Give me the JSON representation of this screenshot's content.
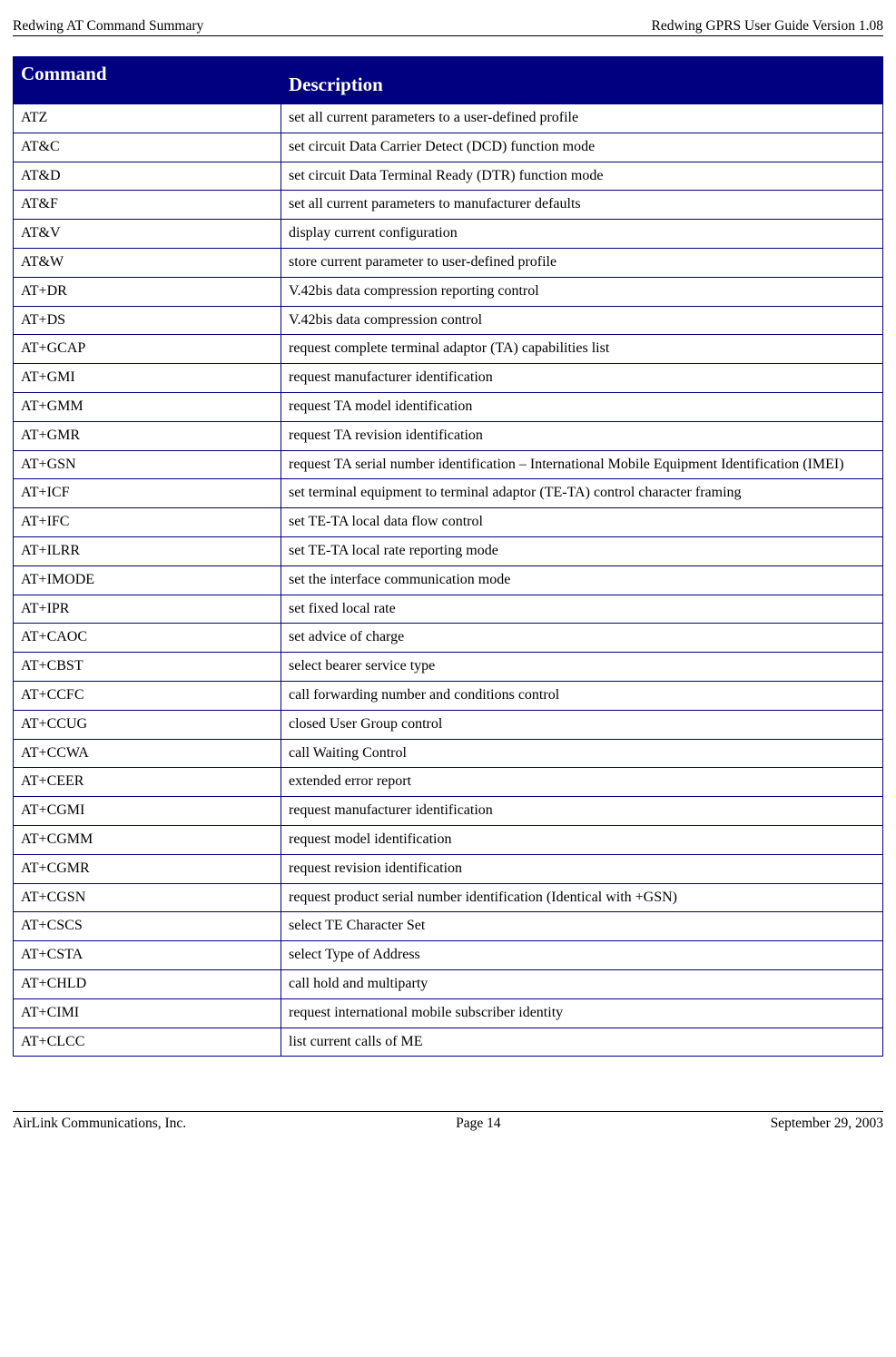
{
  "header": {
    "left": "Redwing AT Command Summary",
    "right": "Redwing GPRS User Guide Version 1.08"
  },
  "table": {
    "header": {
      "command": "Command",
      "description": "Description"
    },
    "rows": [
      {
        "command": "ATZ",
        "description": "set all current parameters to a user-defined profile"
      },
      {
        "command": "AT&C",
        "description": "set circuit Data Carrier Detect (DCD) function mode"
      },
      {
        "command": "AT&D",
        "description": "set circuit Data Terminal Ready (DTR) function mode"
      },
      {
        "command": "AT&F",
        "description": "set all current parameters to manufacturer defaults"
      },
      {
        "command": "AT&V",
        "description": "display current configuration"
      },
      {
        "command": "AT&W",
        "description": "store current parameter to user-defined profile"
      },
      {
        "command": "AT+DR",
        "description": "V.42bis data compression reporting control"
      },
      {
        "command": "AT+DS",
        "description": "V.42bis data compression control"
      },
      {
        "command": "AT+GCAP",
        "description": "request complete terminal adaptor (TA) capabilities list"
      },
      {
        "command": "AT+GMI",
        "description": "request manufacturer identification"
      },
      {
        "command": "AT+GMM",
        "description": "request TA model identification"
      },
      {
        "command": "AT+GMR",
        "description": "request TA revision identification"
      },
      {
        "command": "AT+GSN",
        "description": "request TA serial number identification – International Mobile Equipment Identification (IMEI)"
      },
      {
        "command": "AT+ICF",
        "description": "set terminal equipment to terminal adaptor (TE-TA) control character framing"
      },
      {
        "command": "AT+IFC",
        "description": "set TE-TA local data flow control"
      },
      {
        "command": "AT+ILRR",
        "description": "set TE-TA local rate reporting mode"
      },
      {
        "command": "AT+IMODE",
        "description": "set the interface communication mode"
      },
      {
        "command": "AT+IPR",
        "description": "set fixed local rate"
      },
      {
        "command": "AT+CAOC",
        "description": "set advice of charge"
      },
      {
        "command": "AT+CBST",
        "description": "select bearer service type"
      },
      {
        "command": "AT+CCFC",
        "description": "call forwarding number and conditions control"
      },
      {
        "command": "AT+CCUG",
        "description": "closed User Group control"
      },
      {
        "command": "AT+CCWA",
        "description": "call Waiting Control"
      },
      {
        "command": "AT+CEER",
        "description": "extended error report"
      },
      {
        "command": "AT+CGMI",
        "description": "request manufacturer identification"
      },
      {
        "command": "AT+CGMM",
        "description": "request model identification"
      },
      {
        "command": "AT+CGMR",
        "description": "request revision identification"
      },
      {
        "command": "AT+CGSN",
        "description": "request product serial number identification (Identical with +GSN)"
      },
      {
        "command": "AT+CSCS",
        "description": "select TE Character Set"
      },
      {
        "command": "AT+CSTA",
        "description": "select Type of Address"
      },
      {
        "command": "AT+CHLD",
        "description": "call hold and multiparty"
      },
      {
        "command": "AT+CIMI",
        "description": "request international mobile subscriber identity"
      },
      {
        "command": "AT+CLCC",
        "description": "list current calls of ME"
      }
    ]
  },
  "footer": {
    "left": "AirLink Communications, Inc.",
    "center": "Page 14",
    "right": "September 29, 2003"
  }
}
